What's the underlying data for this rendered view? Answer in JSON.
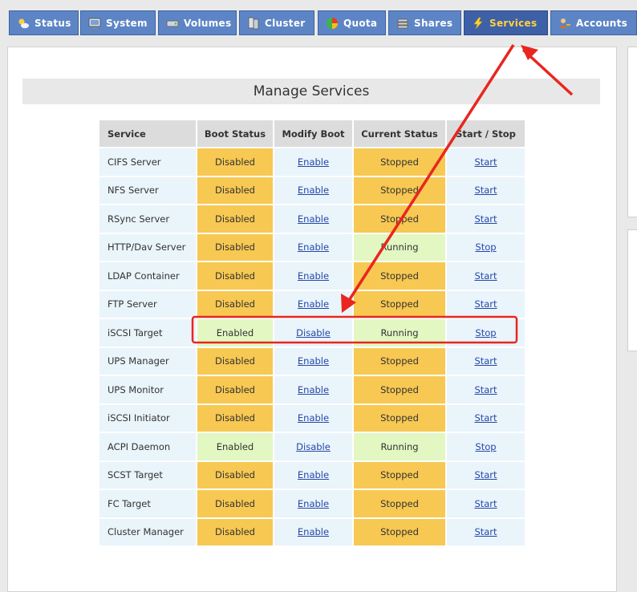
{
  "nav": {
    "tabs": [
      {
        "label": "Status",
        "icon": "sun-cloud-icon",
        "active": false
      },
      {
        "label": "System",
        "icon": "monitor-icon",
        "active": false
      },
      {
        "label": "Volumes",
        "icon": "drive-icon",
        "active": false
      },
      {
        "label": "Cluster",
        "icon": "servers-icon",
        "active": false
      },
      {
        "label": "Quota",
        "icon": "pie-chart-icon",
        "active": false
      },
      {
        "label": "Shares",
        "icon": "stack-icon",
        "active": false
      },
      {
        "label": "Services",
        "icon": "lightning-icon",
        "active": true
      },
      {
        "label": "Accounts",
        "icon": "user-key-icon",
        "active": false
      }
    ]
  },
  "page": {
    "title": "Manage Services"
  },
  "table": {
    "headers": [
      "Service",
      "Boot Status",
      "Modify Boot",
      "Current Status",
      "Start / Stop"
    ],
    "rows": [
      {
        "service": "CIFS Server",
        "boot_status": "Disabled",
        "modify_boot": "Enable",
        "current_status": "Stopped",
        "action": "Start"
      },
      {
        "service": "NFS Server",
        "boot_status": "Disabled",
        "modify_boot": "Enable",
        "current_status": "Stopped",
        "action": "Start"
      },
      {
        "service": "RSync Server",
        "boot_status": "Disabled",
        "modify_boot": "Enable",
        "current_status": "Stopped",
        "action": "Start"
      },
      {
        "service": "HTTP/Dav Server",
        "boot_status": "Disabled",
        "modify_boot": "Enable",
        "current_status": "Running",
        "action": "Stop"
      },
      {
        "service": "LDAP Container",
        "boot_status": "Disabled",
        "modify_boot": "Enable",
        "current_status": "Stopped",
        "action": "Start"
      },
      {
        "service": "FTP Server",
        "boot_status": "Disabled",
        "modify_boot": "Enable",
        "current_status": "Stopped",
        "action": "Start"
      },
      {
        "service": "iSCSI Target",
        "boot_status": "Enabled",
        "modify_boot": "Disable",
        "current_status": "Running",
        "action": "Stop",
        "highlighted": true
      },
      {
        "service": "UPS Manager",
        "boot_status": "Disabled",
        "modify_boot": "Enable",
        "current_status": "Stopped",
        "action": "Start"
      },
      {
        "service": "UPS Monitor",
        "boot_status": "Disabled",
        "modify_boot": "Enable",
        "current_status": "Stopped",
        "action": "Start"
      },
      {
        "service": "iSCSI Initiator",
        "boot_status": "Disabled",
        "modify_boot": "Enable",
        "current_status": "Stopped",
        "action": "Start"
      },
      {
        "service": "ACPI Daemon",
        "boot_status": "Enabled",
        "modify_boot": "Disable",
        "current_status": "Running",
        "action": "Stop"
      },
      {
        "service": "SCST Target",
        "boot_status": "Disabled",
        "modify_boot": "Enable",
        "current_status": "Stopped",
        "action": "Start"
      },
      {
        "service": "FC Target",
        "boot_status": "Disabled",
        "modify_boot": "Enable",
        "current_status": "Stopped",
        "action": "Start"
      },
      {
        "service": "Cluster Manager",
        "boot_status": "Disabled",
        "modify_boot": "Enable",
        "current_status": "Stopped",
        "action": "Start"
      }
    ]
  },
  "colors": {
    "tab": "#5d85c6",
    "tab_active": "#3e60a6",
    "tab_active_text": "#ffd23f",
    "disabled_cell": "#f7c852",
    "enabled_cell": "#e2f7c2",
    "link": "#2448a8",
    "annotation": "#e8261f"
  }
}
